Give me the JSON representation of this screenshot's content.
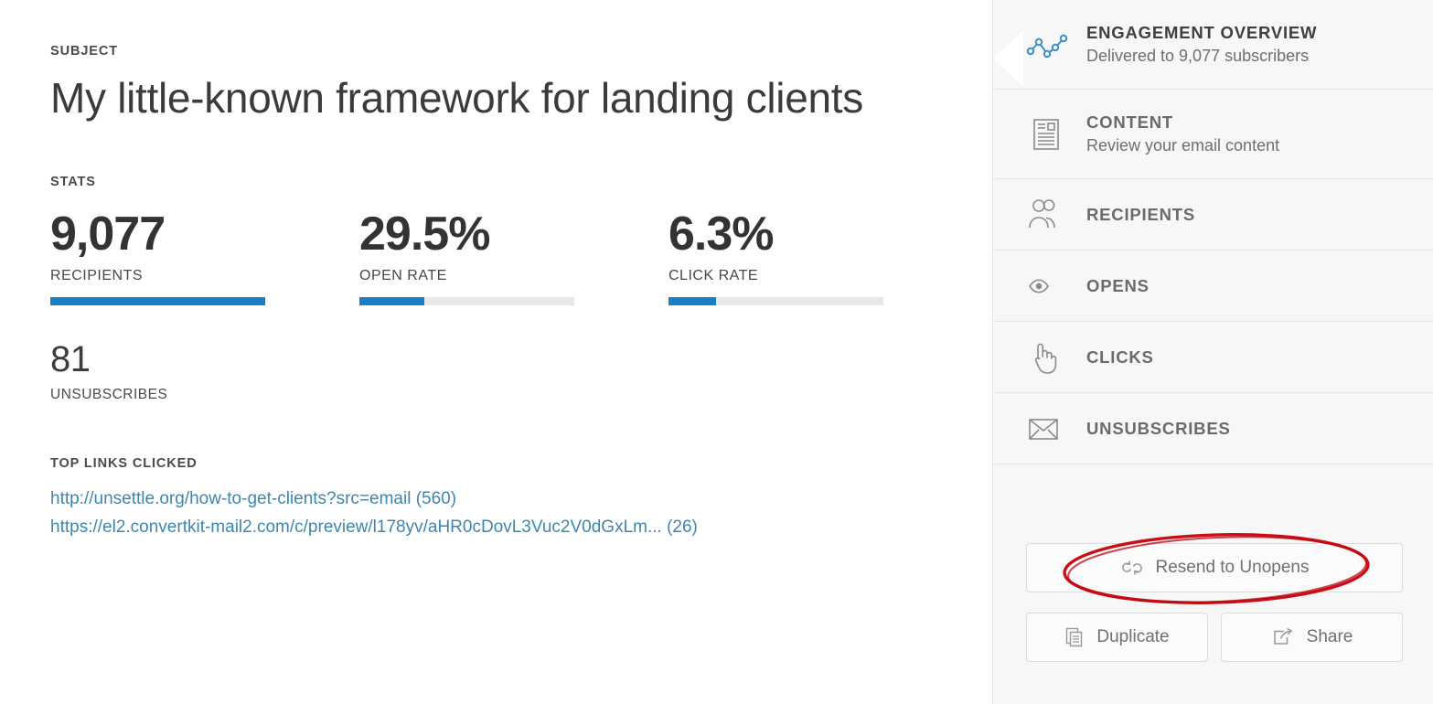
{
  "main": {
    "subject_label": "SUBJECT",
    "subject_text": "My little-known framework for landing clients",
    "stats_label": "STATS",
    "stats": [
      {
        "value": "9,077",
        "name": "RECIPIENTS",
        "fill_percent": 100
      },
      {
        "value": "29.5%",
        "name": "OPEN RATE",
        "fill_percent": 30
      },
      {
        "value": "6.3%",
        "name": "CLICK RATE",
        "fill_percent": 22
      }
    ],
    "unsubscribes": {
      "value": "81",
      "name": "UNSUBSCRIBES"
    },
    "links_label": "TOP LINKS CLICKED",
    "links": [
      {
        "text": "http://unsettle.org/how-to-get-clients?src=email (560)"
      },
      {
        "text": "https://el2.convertkit-mail2.com/c/preview/l178yv/aHR0cDovL3Vuc2V0dGxLm... (26)"
      }
    ]
  },
  "sidebar": {
    "items": [
      {
        "title": "ENGAGEMENT OVERVIEW",
        "subtitle": "Delivered to 9,077 subscribers",
        "icon": "line-chart-icon",
        "active": true
      },
      {
        "title": "CONTENT",
        "subtitle": "Review your email content",
        "icon": "document-icon",
        "active": false
      },
      {
        "title": "RECIPIENTS",
        "subtitle": "",
        "icon": "people-icon",
        "active": false
      },
      {
        "title": "OPENS",
        "subtitle": "",
        "icon": "eye-icon",
        "active": false
      },
      {
        "title": "CLICKS",
        "subtitle": "",
        "icon": "pointing-hand-icon",
        "active": false
      },
      {
        "title": "UNSUBSCRIBES",
        "subtitle": "",
        "icon": "envelope-icon",
        "active": false
      }
    ],
    "actions": {
      "resend_label": "Resend to Unopens",
      "duplicate_label": "Duplicate",
      "share_label": "Share"
    }
  },
  "colors": {
    "accent_blue": "#1b7fc4",
    "icon_blue": "#3e8fc4",
    "link_blue": "#3e87ab",
    "annotation_red": "#cc0c16",
    "sidebar_bg": "#f7f7f7"
  }
}
